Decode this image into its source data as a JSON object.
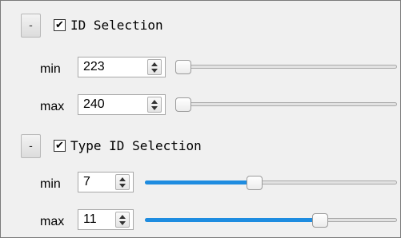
{
  "sections": [
    {
      "collapse_label": "-",
      "checked": true,
      "check_glyph": "✔",
      "title": "ID Selection",
      "min": {
        "label": "min",
        "value": "223",
        "fraction": 0.0
      },
      "max": {
        "label": "max",
        "value": "240",
        "fraction": 0.0
      }
    },
    {
      "collapse_label": "-",
      "checked": true,
      "check_glyph": "✔",
      "title": "Type ID Selection",
      "min": {
        "label": "min",
        "value": "7",
        "fraction": 0.43
      },
      "max": {
        "label": "max",
        "value": "11",
        "fraction": 0.71
      }
    }
  ],
  "colors": {
    "slider_fill": "#1e8ce0",
    "background": "#f0f0f0"
  }
}
